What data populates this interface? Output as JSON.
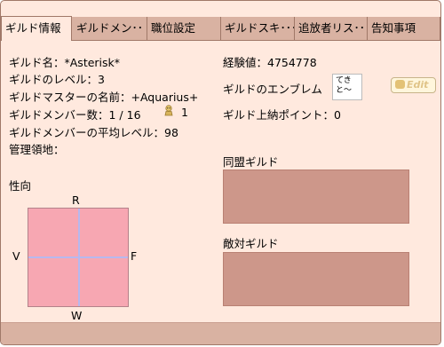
{
  "tabs": [
    {
      "label": "ギルド情報",
      "active": true
    },
    {
      "label": "ギルドメン･･",
      "active": false
    },
    {
      "label": "職位設定",
      "active": false
    },
    {
      "label": "ギルドスキ･･･",
      "active": false
    },
    {
      "label": "追放者リス･･･",
      "active": false
    },
    {
      "label": "告知事項",
      "active": false
    }
  ],
  "info": {
    "guild_name": "ギルド名：*Asterisk*",
    "guild_level": "ギルドのレベル：3",
    "master_name": "ギルドマスターの名前：+Aquarius+",
    "member_count": "ギルドメンバー数：1 / 16",
    "member_online": "1",
    "avg_level": "ギルドメンバーの平均レベル：98",
    "territory": "管理領地："
  },
  "right": {
    "exp": "経験値：4754778",
    "emblem_label": "ギルドのエンブレム",
    "emblem_text": "てき\nと～",
    "edit_label": "Edit",
    "tribute": "ギルド上納ポイント：0",
    "alliance_label": "同盟ギルド",
    "hostile_label": "敵対ギルド"
  },
  "alignment": {
    "label": "性向",
    "top": "R",
    "bottom": "W",
    "left": "V",
    "right": "F"
  },
  "colors": {
    "window_bg": "#ffe9de",
    "tab_bg": "#d9b2a2",
    "guild_box": "#cd978a",
    "alignment_chart": "#f7a7b2",
    "axis_line": "#b7b8ee"
  }
}
